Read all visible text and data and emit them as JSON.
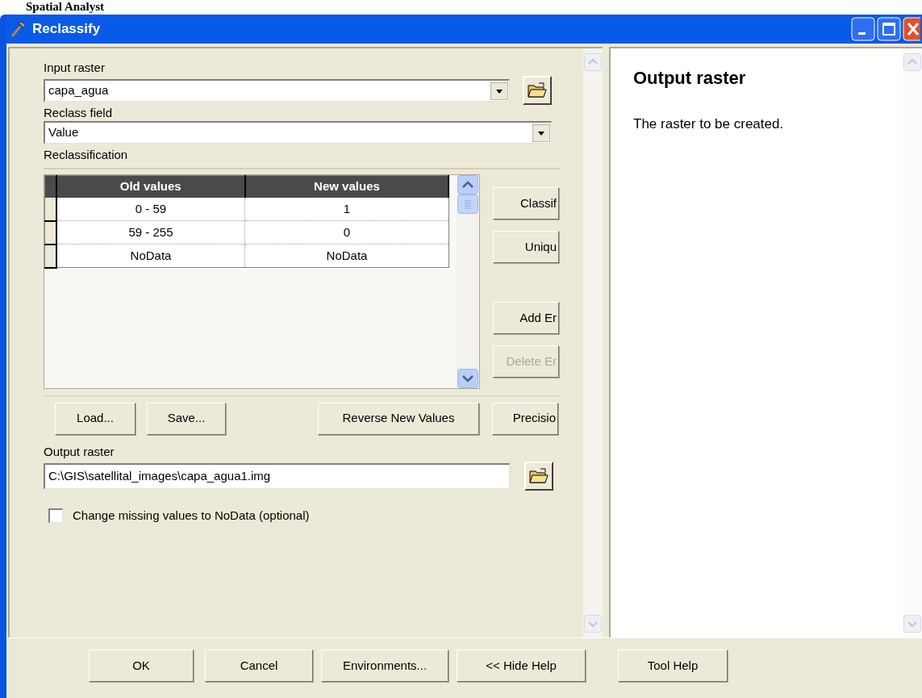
{
  "page_heading": "Spatial Analyst",
  "window": {
    "title": "Reclassify"
  },
  "form": {
    "input_raster": {
      "label": "Input raster",
      "value": "capa_agua"
    },
    "reclass_field": {
      "label": "Reclass field",
      "value": "Value"
    },
    "reclassification": {
      "label": "Reclassification",
      "columns": [
        "Old values",
        "New values"
      ],
      "rows": [
        {
          "old": "0 - 59",
          "new": "1"
        },
        {
          "old": "59 - 255",
          "new": "0"
        },
        {
          "old": "NoData",
          "new": "NoData"
        }
      ],
      "side_buttons": [
        {
          "label": "Classif",
          "disabled": false
        },
        {
          "label": "Uniqu",
          "disabled": false
        },
        {
          "label": "Add Er",
          "disabled": false
        },
        {
          "label": "Delete Er",
          "disabled": true
        }
      ],
      "bottom_buttons": [
        {
          "label": "Load..."
        },
        {
          "label": "Save..."
        },
        {
          "label": "Reverse New Values"
        },
        {
          "label": "Precisio"
        }
      ]
    },
    "output_raster": {
      "label": "Output raster",
      "value": "C:\\GIS\\satellital_images\\capa_agua1.img"
    },
    "option": {
      "label": "Change missing values to NoData (optional)",
      "checked": false
    }
  },
  "help": {
    "title": "Output raster",
    "text": "The raster to be created."
  },
  "buttons": [
    "OK",
    "Cancel",
    "Environments...",
    "<< Hide Help",
    "Tool Help"
  ]
}
